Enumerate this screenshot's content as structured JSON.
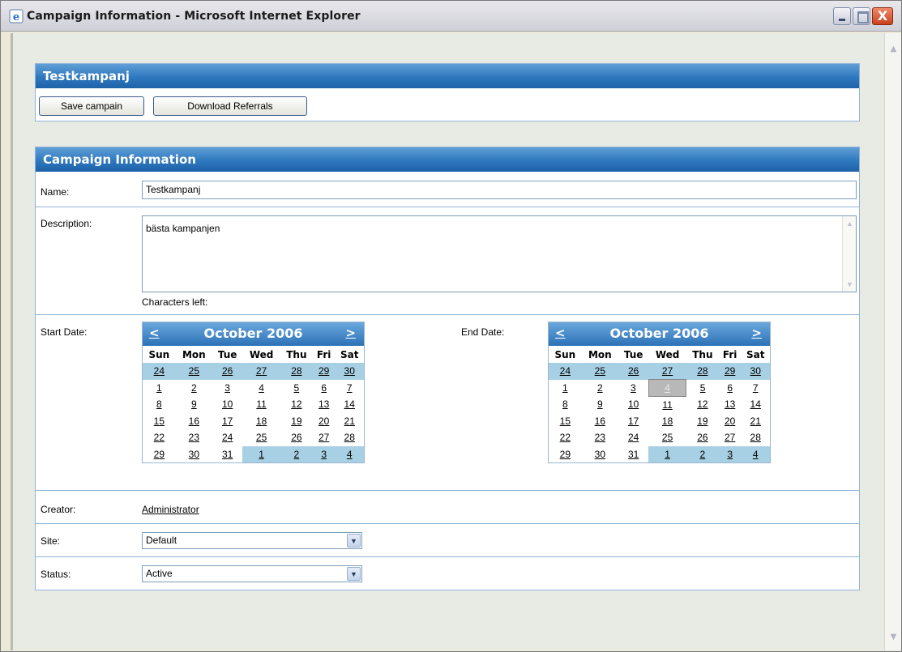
{
  "window": {
    "title": "Campaign Information - Microsoft Internet Explorer",
    "close_glyph": "X"
  },
  "top_panel": {
    "title": "Testkampanj",
    "save_label": "Save campain",
    "download_label": "Download Referrals"
  },
  "info_panel": {
    "title": "Campaign Information",
    "name_label": "Name:",
    "name_value": "Testkampanj",
    "description_label": "Description:",
    "description_value": "bästa kampanjen",
    "chars_left_label": "Characters left:",
    "start_date_label": "Start Date:",
    "end_date_label": "End Date:",
    "creator_label": "Creator:",
    "creator_value": "Administrator",
    "site_label": "Site:",
    "site_value": "Default",
    "status_label": "Status:",
    "status_value": "Active"
  },
  "calendars": {
    "prev_label": "<",
    "next_label": ">",
    "month_label": "October 2006",
    "weekdays": [
      "Sun",
      "Mon",
      "Tue",
      "Wed",
      "Thu",
      "Fri",
      "Sat"
    ],
    "weeks": [
      [
        "24",
        "25",
        "26",
        "27",
        "28",
        "29",
        "30"
      ],
      [
        "1",
        "2",
        "3",
        "4",
        "5",
        "6",
        "7"
      ],
      [
        "8",
        "9",
        "10",
        "11",
        "12",
        "13",
        "14"
      ],
      [
        "15",
        "16",
        "17",
        "18",
        "19",
        "20",
        "21"
      ],
      [
        "22",
        "23",
        "24",
        "25",
        "26",
        "27",
        "28"
      ],
      [
        "29",
        "30",
        "31",
        "1",
        "2",
        "3",
        "4"
      ]
    ],
    "end_selected_day": "4"
  }
}
